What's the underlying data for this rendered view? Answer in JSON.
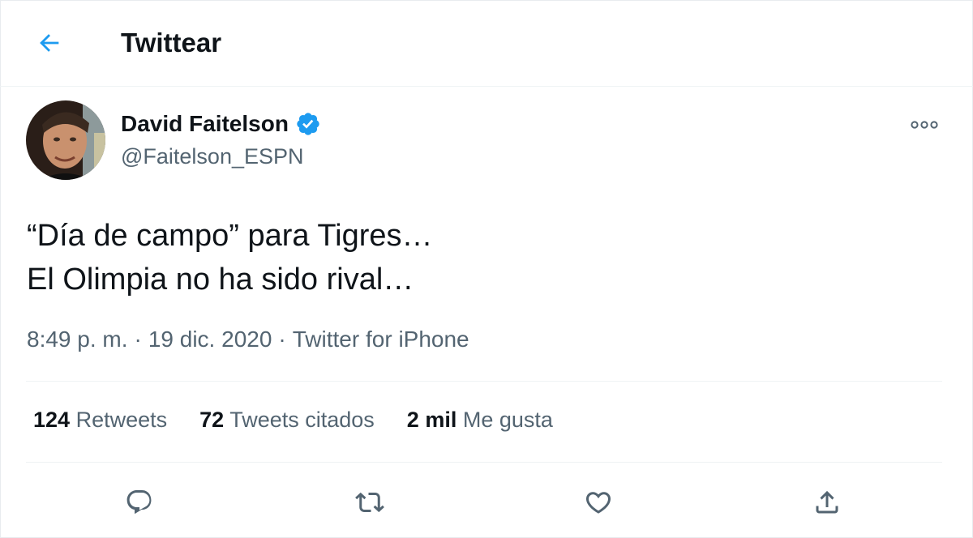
{
  "header": {
    "title": "Twittear",
    "back_icon": "arrow-left-icon"
  },
  "colors": {
    "accent": "#1d9bf0",
    "text": "#0f1419",
    "muted": "#536471",
    "border": "#eff3f4"
  },
  "tweet": {
    "author": {
      "name": "David Faitelson",
      "handle": "@Faitelson_ESPN",
      "verified": true
    },
    "text_lines": [
      "“Día de campo” para Tigres…",
      "El Olimpia no ha sido rival…"
    ],
    "time": "8:49 p. m.",
    "date": "19 dic. 2020",
    "source": "Twitter for iPhone",
    "separator": "·"
  },
  "stats": [
    {
      "value": "124",
      "label": "Retweets"
    },
    {
      "value": "72",
      "label": "Tweets citados"
    },
    {
      "value": "2 mil",
      "label": "Me gusta"
    }
  ],
  "actions": [
    "reply-icon",
    "retweet-icon",
    "like-icon",
    "share-icon"
  ]
}
